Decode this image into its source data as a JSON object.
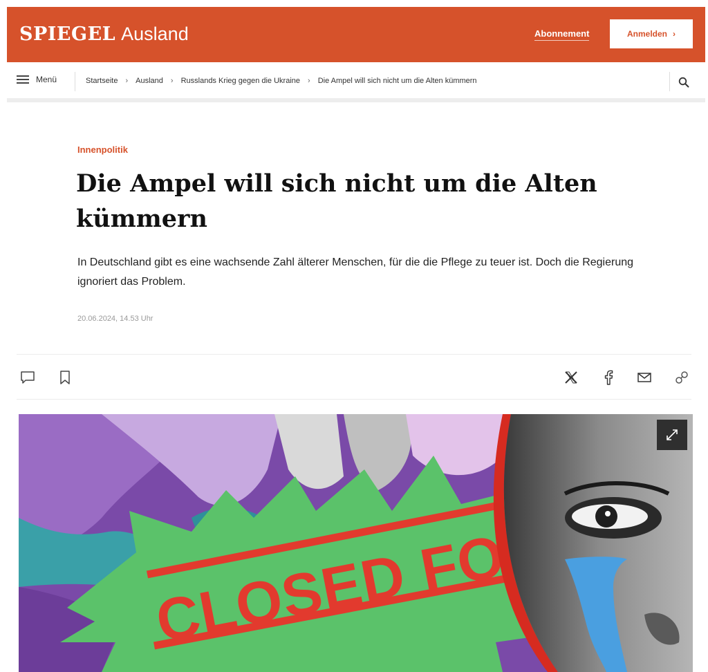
{
  "header": {
    "brand": "SPIEGEL",
    "section": "Ausland",
    "subscription_label": "Abonnement",
    "login_label": "Anmelden",
    "login_arrow": "›",
    "brand_color": "#d6522b"
  },
  "navbar": {
    "menu_label": "Menü",
    "breadcrumbs": [
      "Startseite",
      "Ausland",
      "Russlands Krieg gegen die Ukraine",
      "Die Ampel will sich nicht um die Alten kümmern"
    ],
    "separator": "›",
    "search_icon": "search-icon"
  },
  "article": {
    "kicker": "Innenpolitik",
    "headline": "Die Ampel will sich nicht um die Alten kümmern",
    "lead": "In Deutschland gibt es eine wachsende Zahl älterer Menschen, für die die Pflege zu teuer ist. Doch die Regierung ignoriert das Problem.",
    "date": "20.06.2024, 14.53 Uhr"
  },
  "actions": {
    "left": [
      "comment-icon",
      "bookmark-icon"
    ],
    "share": [
      "x-icon",
      "facebook-icon",
      "mail-icon",
      "link-icon"
    ]
  },
  "hero": {
    "stamp_text": "CLOSED FOREVER",
    "expand_icon": "expand-icon"
  }
}
